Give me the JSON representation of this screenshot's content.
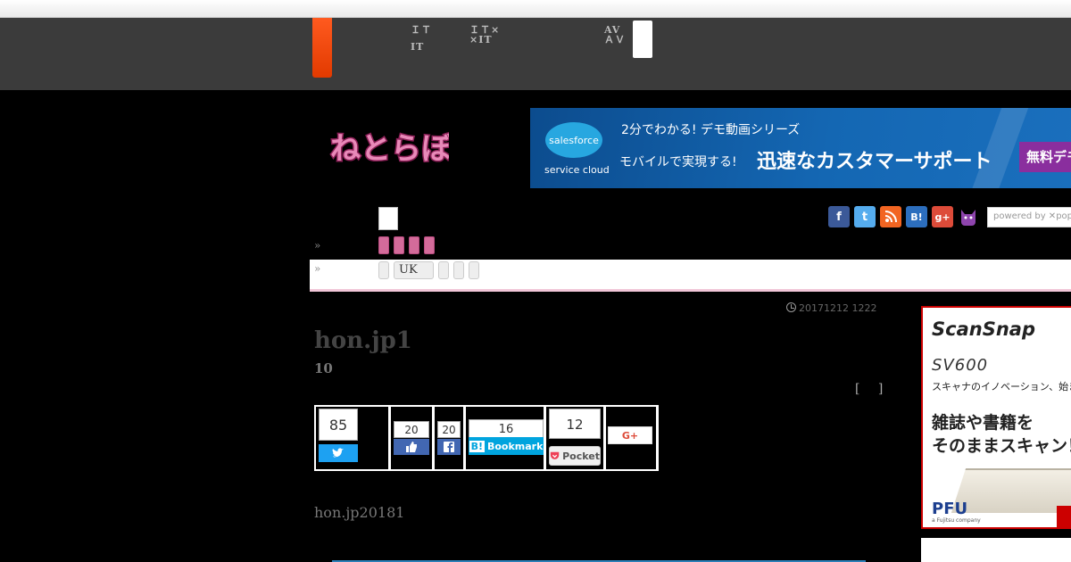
{
  "nav": {
    "items": [
      {
        "line1": "ＩＴ",
        "line2": "IT"
      },
      {
        "line1": "ＩＴ×",
        "line2": "×IT"
      },
      {
        "line1": "AV",
        "line2": "ＡＶ"
      }
    ]
  },
  "banner": {
    "logo_text": "salesforce",
    "logo_sub": "service cloud",
    "line1": "2分でわかる! デモ動画シリーズ",
    "line2a": "モバイルで実現する!",
    "line2b": "迅速なカスタマーサポート",
    "cta": "無料デモ"
  },
  "social": {
    "icons": [
      "facebook-icon",
      "twitter-icon",
      "rss-icon",
      "hatena-icon",
      "googleplus-icon",
      "cat-icon"
    ],
    "labels": [
      "f",
      "t",
      "",
      "B!",
      "g+",
      ""
    ],
    "colors": [
      "#3b5998",
      "#55acee",
      "#f26522",
      "#2c6ebd",
      "#dd4b39",
      "#8e44ad"
    ],
    "powered_by": "powered by ✕pop"
  },
  "breadcrumb": {
    "arrow1": "»",
    "arrow2": "»",
    "tag_uk": "UK"
  },
  "article": {
    "timestamp": "20171212 1222",
    "title": "hon.jp1",
    "subtitle": "10",
    "brackets": "[ ]",
    "body": "hon.jp20181"
  },
  "share": {
    "twitter_count": "85",
    "like_count": "20",
    "fb_share_count": "20",
    "bookmark_count": "16",
    "bookmark_label": "Bookmark",
    "pocket_count": "12",
    "pocket_label": "Pocket",
    "gplus_label": "G+"
  },
  "side_ad": {
    "brand": "ScanSnap",
    "model": "SV600",
    "tagline": "スキャナのイノベーション、始まる",
    "headline_line1": "雑誌や書籍を",
    "headline_line2": "そのままスキャン！",
    "maker": "PFU",
    "maker_sub": "a Fujitsu company"
  }
}
